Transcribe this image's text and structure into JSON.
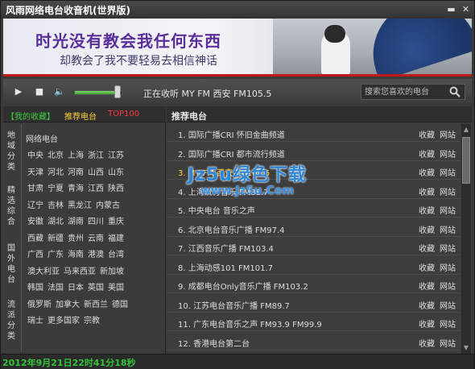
{
  "window": {
    "title": "风雨网络电台收音机(世界版)",
    "min_label": "▬",
    "close_label": "✕"
  },
  "banner": {
    "line1": "时光没有教会我任何东西",
    "line2": "却教会了我不要轻易去相信神话"
  },
  "player": {
    "now_playing": "正在收听  MY FM 西安  FM105.5",
    "volume": 0.85,
    "search_placeholder": "搜索您喜欢的电台"
  },
  "left": {
    "tabs": [
      {
        "label": "【我的收藏】",
        "color": "#3fd03f"
      },
      {
        "label": "推荐电台",
        "color": "#ffcf3a"
      },
      {
        "label": "TOP100",
        "color": "#ff3a3a"
      }
    ],
    "vcats": [
      "地域分类",
      "精选综合",
      "国外电台",
      "流派分类"
    ],
    "head": "网络电台",
    "regions": [
      [
        "中央",
        "北京",
        "上海",
        "浙江",
        "江苏"
      ],
      [
        "天津",
        "河北",
        "河南",
        "山西",
        "山东"
      ],
      [
        "甘肃",
        "宁夏",
        "青海",
        "江西",
        "陕西"
      ],
      [
        "辽宁",
        "吉林",
        "黑龙江",
        "内蒙古"
      ],
      [
        "安徽",
        "湖北",
        "湖南",
        "四川",
        "重庆"
      ],
      [
        "西藏",
        "新疆",
        "贵州",
        "云南",
        "福建"
      ],
      [
        "广西",
        "广东",
        "海南",
        "港澳",
        "台湾"
      ],
      [
        "澳大利亚",
        "马来西亚",
        "新加坡"
      ],
      [
        "韩国",
        "法国",
        "日本",
        "英国",
        "美国"
      ],
      [
        "俄罗斯",
        "加拿大",
        "新西兰",
        "德国"
      ],
      [
        "瑞士",
        "更多国家",
        "宗教"
      ]
    ]
  },
  "right": {
    "heading": "推荐电台",
    "fav_label": "收藏",
    "site_label": "网站",
    "stations": [
      "1. 国际广播CRI 怀旧金曲频道",
      "2. 国际广播CRI 都市流行频道",
      "3. MY FM 西安 FM105.5",
      "4. 上海流行音乐 FM88.7",
      "5. 中央电台 音乐之声",
      "6. 北京电台音乐广播 FM97.4",
      "7. 江西音乐广播 FM103.4",
      "8. 上海动感101 FM101.7",
      "9. 成都电台Only音乐广播 FM103.2",
      "10. 江苏电台音乐广播 FM89.7",
      "11. 广东电台音乐之声 FM93.9 FM99.9",
      "12. 香港电台第二台"
    ],
    "active_index": 2
  },
  "watermark": {
    "big": "Jz5u绿色下载",
    "small": "www.Jz5u.Com"
  },
  "status": {
    "clock": "2012年9月21日22时41分18秒"
  }
}
